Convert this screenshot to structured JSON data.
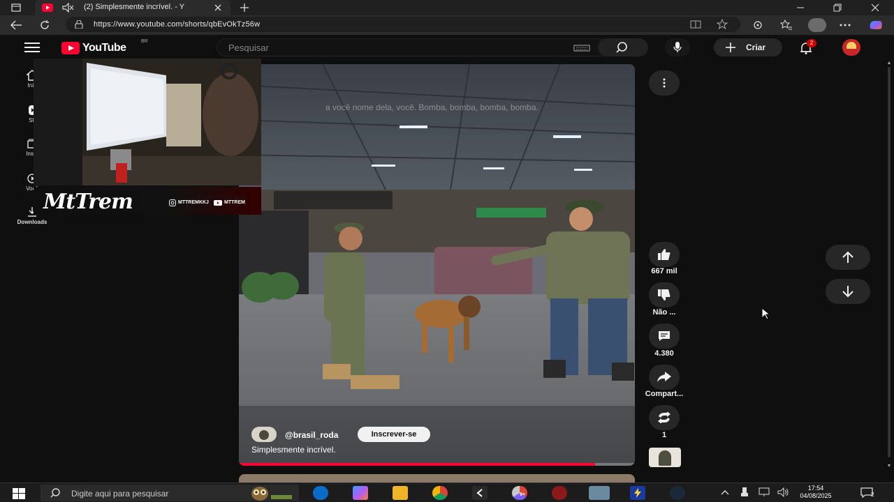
{
  "browser": {
    "tab_title": "(2) Simplesmente incrível. - Y",
    "url": "https://www.youtube.com/shorts/qbEvOkTz56w"
  },
  "header": {
    "logo": "YouTube",
    "region": "BR",
    "search_placeholder": "Pesquisar",
    "create_label": "Criar",
    "notification_count": "2"
  },
  "sidebar": {
    "items": [
      {
        "label": "Iníc",
        "icon": "home-icon"
      },
      {
        "label": "Sh",
        "icon": "shorts-icon"
      },
      {
        "label": "Inscr",
        "icon": "subscriptions-icon"
      },
      {
        "label": "Você",
        "icon": "you-icon"
      },
      {
        "label": "Downloads",
        "icon": "download-icon"
      }
    ]
  },
  "overlay": {
    "streamer_name": "MtTrem",
    "instagram": "MTTREMKKJ",
    "youtube": "MTTREM"
  },
  "video": {
    "caption": "a você nome dela, você. Bomba, bomba, bomba, bomba.",
    "channel": "@brasil_roda",
    "subscribe_label": "Inscrever-se",
    "title": "Simplesmente incrível.",
    "progress": 0.9
  },
  "actions": {
    "likes": "667 mil",
    "dislike": "Não ...",
    "comments": "4.380",
    "share": "Compart...",
    "remix": "1"
  },
  "taskbar": {
    "search_placeholder": "Digite aqui para pesquisar",
    "time": "17:54",
    "date": "04/08/2025",
    "chat_count": "2",
    "chrome_badge": "9+"
  },
  "colors": {
    "accent": "#ff0033",
    "background": "#0f0f0f",
    "button": "#272727"
  }
}
